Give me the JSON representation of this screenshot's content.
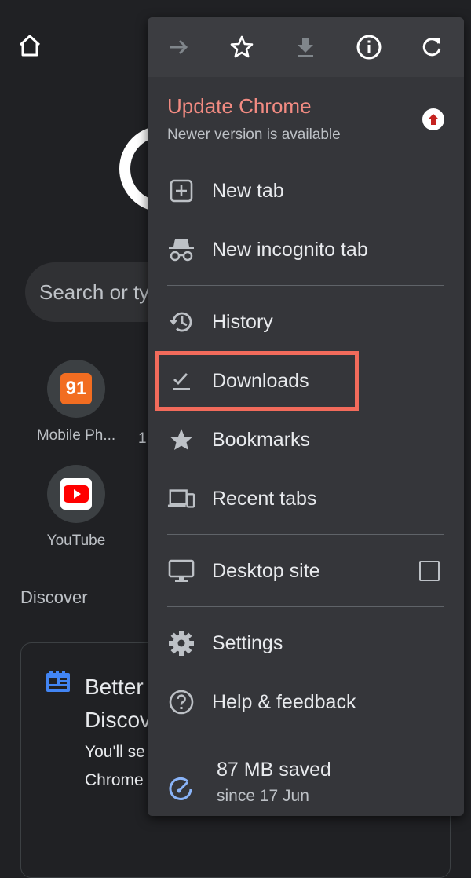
{
  "page": {
    "search_placeholder": "Search or ty",
    "tiles": [
      {
        "label": "Mobile Ph...",
        "badge": "91"
      },
      {
        "label": "YouTube"
      }
    ],
    "tile_extra": "1",
    "discover_label": "Discover",
    "card": {
      "title": "Better Discov",
      "body": "You'll se interest in your off Discover in Chrome at any time."
    }
  },
  "menu": {
    "toolbar": [
      "forward-icon",
      "bookmark-star-icon",
      "download-icon",
      "info-icon",
      "reload-icon"
    ],
    "update": {
      "title": "Update Chrome",
      "subtitle": "Newer version is available"
    },
    "items": {
      "new_tab": "New tab",
      "incognito": "New incognito tab",
      "history": "History",
      "downloads": "Downloads",
      "bookmarks": "Bookmarks",
      "recent_tabs": "Recent tabs",
      "desktop_site": "Desktop site",
      "settings": "Settings",
      "help": "Help & feedback"
    },
    "desktop_site_checked": false,
    "saved": {
      "title": "87 MB saved",
      "subtitle": "since 17 Jun"
    }
  },
  "colors": {
    "accent_update": "#f28b82",
    "highlight": "#f26b5b",
    "menu_bg": "#35363a",
    "page_bg": "#202124"
  }
}
